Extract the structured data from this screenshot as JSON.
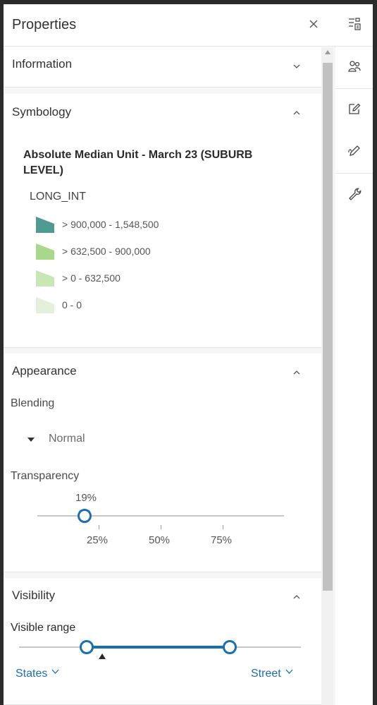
{
  "panel": {
    "title": "Properties"
  },
  "sections": {
    "information": {
      "title": "Information"
    },
    "symbology": {
      "title": "Symbology",
      "legend_title": "Absolute Median Unit - March 23 (SUBURB LEVEL)",
      "field": "LONG_INT",
      "items": [
        {
          "label": "> 900,000 - 1,548,500",
          "color": "#4f9a93"
        },
        {
          "label": "> 632,500 - 900,000",
          "color": "#a8d98a"
        },
        {
          "label": "> 0 - 632,500",
          "color": "#c9e7b3"
        },
        {
          "label": "0 - 0",
          "color": "#e4f0dc"
        }
      ]
    },
    "appearance": {
      "title": "Appearance",
      "blending_label": "Blending",
      "blending_value": "Normal",
      "transparency_label": "Transparency",
      "transparency_value": "19%",
      "transparency_percent": 19,
      "ticks": [
        "25%",
        "50%",
        "75%"
      ]
    },
    "visibility": {
      "title": "Visibility",
      "visible_range_label": "Visible range",
      "range_min": "States",
      "range_max": "Street"
    }
  },
  "colors": {
    "accent": "#1a6faf",
    "scale_1": "#4f9a93",
    "scale_2": "#a8d98a",
    "scale_3": "#c9e7b3",
    "scale_4": "#e4f0dc"
  },
  "toolbar": {
    "icons": [
      "layer-properties-icon",
      "layer-style-icon",
      "edit-icon",
      "sketch-icon",
      "wrench-icon"
    ]
  }
}
